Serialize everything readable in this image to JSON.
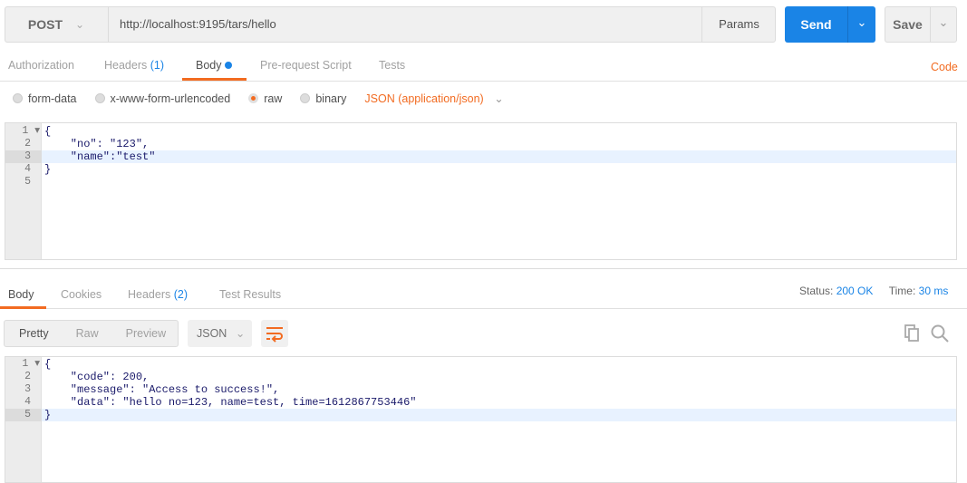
{
  "request": {
    "method": "POST",
    "url": "http://localhost:9195/tars/hello",
    "params_label": "Params",
    "send_label": "Send",
    "save_label": "Save"
  },
  "req_tabs": {
    "authorization": "Authorization",
    "headers": "Headers",
    "headers_count": "(1)",
    "body": "Body",
    "prerequest": "Pre-request Script",
    "tests": "Tests",
    "code": "Code"
  },
  "body_types": {
    "form_data": "form-data",
    "urlencoded": "x-www-form-urlencoded",
    "raw": "raw",
    "binary": "binary",
    "content_type": "JSON (application/json)",
    "selected": "raw"
  },
  "request_body": {
    "lines": [
      "{",
      "    \"no\": \"123\",",
      "    \"name\":\"test\"",
      "}",
      ""
    ],
    "active_line": 3
  },
  "resp_tabs": {
    "body": "Body",
    "cookies": "Cookies",
    "headers": "Headers",
    "headers_count": "(2)",
    "test_results": "Test Results"
  },
  "status": {
    "status_label": "Status:",
    "status_value": "200 OK",
    "time_label": "Time:",
    "time_value": "30 ms"
  },
  "resp_toolbar": {
    "pretty": "Pretty",
    "raw": "Raw",
    "preview": "Preview",
    "format": "JSON"
  },
  "response_body": {
    "lines": [
      "{",
      "    \"code\": 200,",
      "    \"message\": \"Access to success!\",",
      "    \"data\": \"hello no=123, name=test, time=1612867753446\"",
      "}"
    ],
    "active_line": 5
  },
  "icons": {
    "wrap": "wrap-lines-icon",
    "copy": "copy-icon",
    "search": "search-icon"
  },
  "colors": {
    "accent": "#f26b21",
    "send": "#1a84e6"
  }
}
